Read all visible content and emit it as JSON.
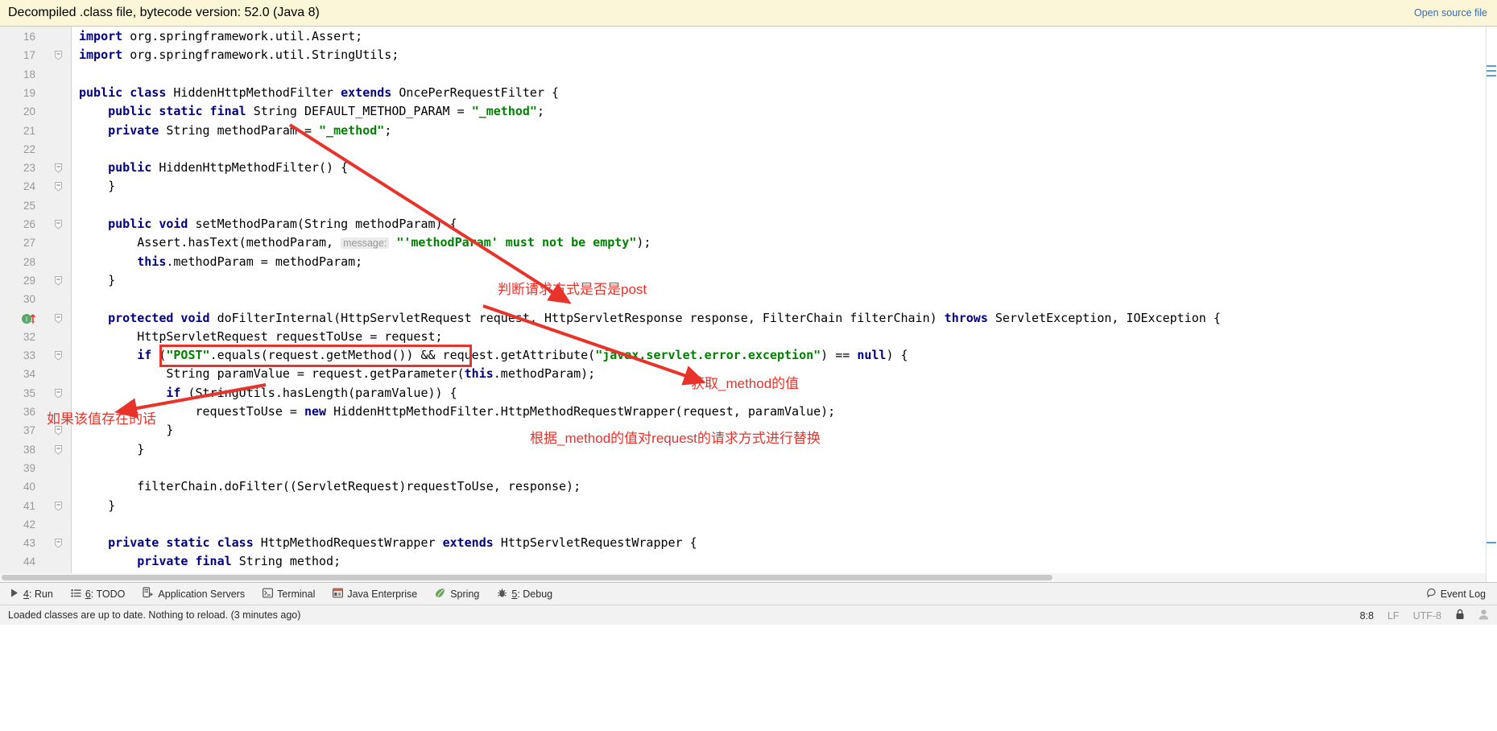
{
  "banner": {
    "text": "Decompiled .class file, bytecode version: 52.0 (Java 8)",
    "link": "Open source file"
  },
  "editor": {
    "first_line": 16,
    "lines": [
      {
        "n": 16,
        "tokens": [
          {
            "t": "import ",
            "c": "kw"
          },
          {
            "t": "org.springframework.util.Assert;",
            "c": "id"
          }
        ],
        "fold": false
      },
      {
        "n": 17,
        "tokens": [
          {
            "t": "import ",
            "c": "kw"
          },
          {
            "t": "org.springframework.util.StringUtils;",
            "c": "id"
          }
        ],
        "fold": true
      },
      {
        "n": 18,
        "tokens": [],
        "fold": false
      },
      {
        "n": 19,
        "tokens": [
          {
            "t": "public class ",
            "c": "kw"
          },
          {
            "t": "HiddenHttpMethodFilter ",
            "c": "id"
          },
          {
            "t": "extends ",
            "c": "kw"
          },
          {
            "t": "OncePerRequestFilter {",
            "c": "id"
          }
        ],
        "fold": false
      },
      {
        "n": 20,
        "tokens": [
          {
            "t": "    ",
            "c": "id"
          },
          {
            "t": "public static final ",
            "c": "kw"
          },
          {
            "t": "String DEFAULT_METHOD_PARAM = ",
            "c": "id"
          },
          {
            "t": "\"_method\"",
            "c": "str"
          },
          {
            "t": ";",
            "c": "id"
          }
        ],
        "fold": false
      },
      {
        "n": 21,
        "tokens": [
          {
            "t": "    ",
            "c": "id"
          },
          {
            "t": "private ",
            "c": "kw"
          },
          {
            "t": "String methodParam = ",
            "c": "id"
          },
          {
            "t": "\"_method\"",
            "c": "str"
          },
          {
            "t": ";",
            "c": "id"
          }
        ],
        "fold": false
      },
      {
        "n": 22,
        "tokens": [],
        "fold": false
      },
      {
        "n": 23,
        "tokens": [
          {
            "t": "    ",
            "c": "id"
          },
          {
            "t": "public ",
            "c": "kw"
          },
          {
            "t": "HiddenHttpMethodFilter() {",
            "c": "id"
          }
        ],
        "fold": true
      },
      {
        "n": 24,
        "tokens": [
          {
            "t": "    }",
            "c": "id"
          }
        ],
        "fold": true
      },
      {
        "n": 25,
        "tokens": [],
        "fold": false
      },
      {
        "n": 26,
        "tokens": [
          {
            "t": "    ",
            "c": "id"
          },
          {
            "t": "public void ",
            "c": "kw"
          },
          {
            "t": "setMethodParam(String methodParam) {",
            "c": "id"
          }
        ],
        "fold": true
      },
      {
        "n": 27,
        "tokens": [
          {
            "t": "        Assert.hasText(methodParam, ",
            "c": "id"
          },
          {
            "t": "message:",
            "c": "hint"
          },
          {
            "t": " ",
            "c": "id"
          },
          {
            "t": "\"'methodParam' must not be empty\"",
            "c": "str"
          },
          {
            "t": ");",
            "c": "id"
          }
        ],
        "fold": false
      },
      {
        "n": 28,
        "tokens": [
          {
            "t": "        ",
            "c": "id"
          },
          {
            "t": "this",
            "c": "kw"
          },
          {
            "t": ".methodParam = methodParam;",
            "c": "id"
          }
        ],
        "fold": false
      },
      {
        "n": 29,
        "tokens": [
          {
            "t": "    }",
            "c": "id"
          }
        ],
        "fold": true
      },
      {
        "n": 30,
        "tokens": [],
        "fold": false
      },
      {
        "n": 31,
        "tokens": [
          {
            "t": "    ",
            "c": "id"
          },
          {
            "t": "protected void ",
            "c": "kw"
          },
          {
            "t": "doFilterInternal(HttpServletRequest request, HttpServletResponse response, FilterChain filterChain) ",
            "c": "id"
          },
          {
            "t": "throws ",
            "c": "kw"
          },
          {
            "t": "ServletException, IOException {",
            "c": "id"
          }
        ],
        "fold": true,
        "run_icon": true
      },
      {
        "n": 32,
        "tokens": [
          {
            "t": "        HttpServletRequest requestToUse = request;",
            "c": "id"
          }
        ],
        "fold": false
      },
      {
        "n": 33,
        "tokens": [
          {
            "t": "        ",
            "c": "id"
          },
          {
            "t": "if ",
            "c": "kw"
          },
          {
            "t": "(",
            "c": "id"
          },
          {
            "t": "\"POST\"",
            "c": "str"
          },
          {
            "t": ".equals(request.getMethod()) && request.getAttribute(",
            "c": "id"
          },
          {
            "t": "\"javax.servlet.error.exception\"",
            "c": "str"
          },
          {
            "t": ") == ",
            "c": "id"
          },
          {
            "t": "null",
            "c": "kw"
          },
          {
            "t": ") {",
            "c": "id"
          }
        ],
        "fold": true
      },
      {
        "n": 34,
        "tokens": [
          {
            "t": "            String paramValue = request.getParameter(",
            "c": "id"
          },
          {
            "t": "this",
            "c": "kw"
          },
          {
            "t": ".methodParam);",
            "c": "id"
          }
        ],
        "fold": false
      },
      {
        "n": 35,
        "tokens": [
          {
            "t": "            ",
            "c": "id"
          },
          {
            "t": "if ",
            "c": "kw"
          },
          {
            "t": "(StringUtils.hasLength(paramValue)) {",
            "c": "id"
          }
        ],
        "fold": true
      },
      {
        "n": 36,
        "tokens": [
          {
            "t": "                requestToUse = ",
            "c": "id"
          },
          {
            "t": "new ",
            "c": "kw"
          },
          {
            "t": "HiddenHttpMethodFilter.HttpMethodRequestWrapper(request, paramValue);",
            "c": "id"
          }
        ],
        "fold": false
      },
      {
        "n": 37,
        "tokens": [
          {
            "t": "            }",
            "c": "id"
          }
        ],
        "fold": true
      },
      {
        "n": 38,
        "tokens": [
          {
            "t": "        }",
            "c": "id"
          }
        ],
        "fold": true
      },
      {
        "n": 39,
        "tokens": [],
        "fold": false
      },
      {
        "n": 40,
        "tokens": [
          {
            "t": "        filterChain.doFilter((ServletRequest)requestToUse, response);",
            "c": "id"
          }
        ],
        "fold": false
      },
      {
        "n": 41,
        "tokens": [
          {
            "t": "    }",
            "c": "id"
          }
        ],
        "fold": true
      },
      {
        "n": 42,
        "tokens": [],
        "fold": false
      },
      {
        "n": 43,
        "tokens": [
          {
            "t": "    ",
            "c": "id"
          },
          {
            "t": "private static class ",
            "c": "kw"
          },
          {
            "t": "HttpMethodRequestWrapper ",
            "c": "id"
          },
          {
            "t": "extends ",
            "c": "kw"
          },
          {
            "t": "HttpServletRequestWrapper {",
            "c": "id"
          }
        ],
        "fold": true
      },
      {
        "n": 44,
        "tokens": [
          {
            "t": "        ",
            "c": "id"
          },
          {
            "t": "private final ",
            "c": "kw"
          },
          {
            "t": "String method;",
            "c": "id"
          }
        ],
        "fold": false
      }
    ]
  },
  "annotations": {
    "note_post": "判断请求方式是否是post",
    "note_get_method": "获取_method的值",
    "note_if_exists": "如果该值存在的话",
    "note_replace": "根据_method的值对request的请求方式进行替换",
    "color": "#e8332a"
  },
  "toolbar": {
    "items": [
      {
        "icon": "run-icon",
        "num": "4",
        "label": ": Run"
      },
      {
        "icon": "todo-icon",
        "num": "6",
        "label": ": TODO"
      },
      {
        "icon": "app-servers-icon",
        "num": "",
        "label": "Application Servers"
      },
      {
        "icon": "terminal-icon",
        "num": "",
        "label": "Terminal"
      },
      {
        "icon": "java-enterprise-icon",
        "num": "",
        "label": "Java Enterprise"
      },
      {
        "icon": "spring-icon",
        "num": "",
        "label": "Spring"
      },
      {
        "icon": "debug-icon",
        "num": "5",
        "label": ": Debug"
      }
    ],
    "event_log": "Event Log"
  },
  "status": {
    "message": "Loaded classes are up to date. Nothing to reload. (3 minutes ago)",
    "caret": "8:8",
    "line_separator": "LF",
    "encoding": "UTF-8",
    "lock": "lock-icon",
    "user": "user-icon"
  }
}
